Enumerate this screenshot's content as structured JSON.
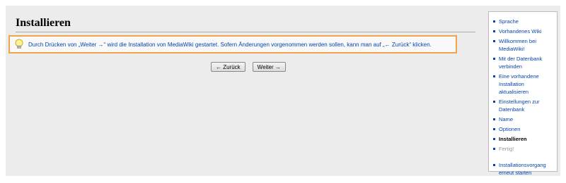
{
  "page": {
    "title": "Installieren"
  },
  "notice": {
    "text": "Durch Drücken von „Weiter →“ wird die Installation von MediaWiki gestartet. Sofern Änderungen vorgenommen werden sollen, kann man auf „← Zurück“ klicken.",
    "icon": "lightbulb-icon"
  },
  "buttons": {
    "back": "← Zurück",
    "next": "Weiter →"
  },
  "sidebar": {
    "steps": [
      {
        "label": "Sprache",
        "state": "done"
      },
      {
        "label": "Vorhandenes Wiki",
        "state": "done"
      },
      {
        "label": "Willkommen bei MediaWiki!",
        "state": "done"
      },
      {
        "label": "Mit der Datenbank verbinden",
        "state": "done"
      },
      {
        "label": "Eine vorhandene Installation aktualisieren",
        "state": "done"
      },
      {
        "label": "Einstellungen zur Datenbank",
        "state": "done"
      },
      {
        "label": "Name",
        "state": "done"
      },
      {
        "label": "Optionen",
        "state": "done"
      },
      {
        "label": "Installieren",
        "state": "current"
      },
      {
        "label": "Fertig!",
        "state": "future"
      }
    ],
    "restart": "Installationsvorgang erneut starten"
  },
  "colors": {
    "link": "#0645ad",
    "notice_border": "#f0a54a",
    "background": "#ececec"
  }
}
